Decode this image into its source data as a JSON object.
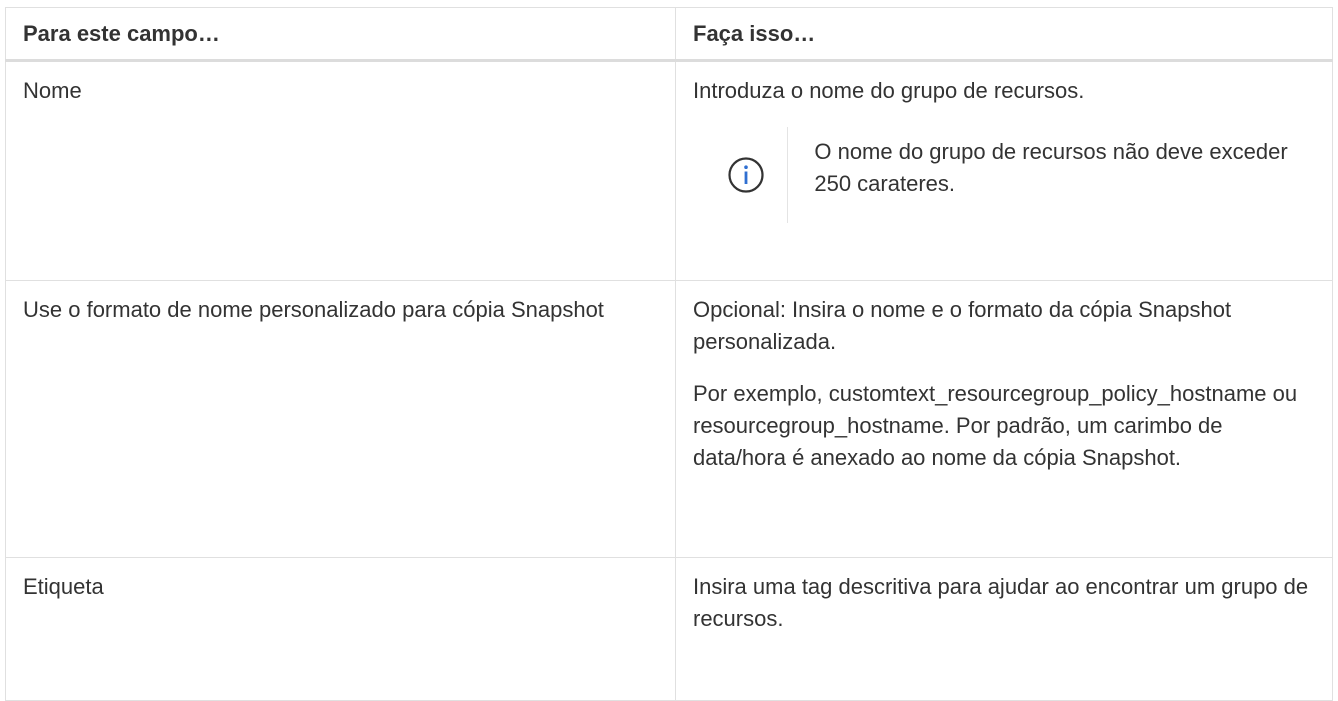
{
  "table": {
    "headers": {
      "field": "Para este campo…",
      "action": "Faça isso…"
    },
    "rows": [
      {
        "field": "Nome",
        "action": {
          "text": "Introduza o nome do grupo de recursos.",
          "note": {
            "icon": "info-circle-icon",
            "text": "O nome do grupo de recursos não deve exceder 250 carateres."
          }
        }
      },
      {
        "field": "Use o formato de nome personalizado para cópia Snapshot",
        "action": {
          "paragraphs": [
            "Opcional: Insira o nome e o formato da cópia Snapshot personalizada.",
            "Por exemplo, customtext_resourcegroup_policy_hostname ou resourcegroup_hostname. Por padrão, um carimbo de data/hora é anexado ao nome da cópia Snapshot."
          ]
        }
      },
      {
        "field": "Etiqueta",
        "action": {
          "text": "Insira uma tag descritiva para ajudar ao encontrar um grupo de recursos."
        }
      }
    ]
  },
  "colors": {
    "text": "#333333",
    "border": "#e0e0e0",
    "icon": "#333333"
  }
}
